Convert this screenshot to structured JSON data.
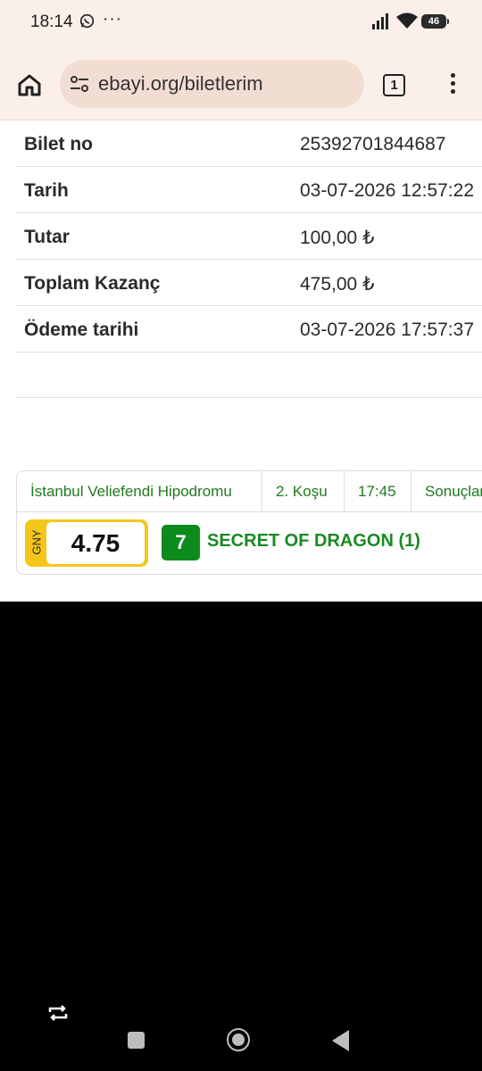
{
  "status": {
    "time": "18:14",
    "dots": "···",
    "battery": "46"
  },
  "browser": {
    "url": "ebayi.org/biletlerim",
    "tab_count": "1"
  },
  "ticket": {
    "rows": [
      {
        "label": "Bilet no",
        "value": "25392701844687"
      },
      {
        "label": "Tarih",
        "value": "03-07-2026 12:57:22"
      },
      {
        "label": "Tutar",
        "value": "100,00 ₺"
      },
      {
        "label": "Toplam Kazanç",
        "value": "475,00 ₺"
      },
      {
        "label": "Ödeme tarihi",
        "value": "03-07-2026 17:57:37"
      }
    ]
  },
  "race": {
    "track": "İstanbul Veliefendi Hipodromu",
    "race_no": "2. Koşu",
    "time": "17:45",
    "result": "Sonuçlandı",
    "odds_label": "GNY",
    "odds_value": "4.75",
    "horse_number": "7",
    "horse_name": "SECRET OF DRAGON (1)"
  },
  "icons": [
    "whatsapp-icon",
    "signal-icon",
    "wifi-icon",
    "home-icon",
    "site-settings-icon",
    "more-vert-icon",
    "rotate-icon"
  ]
}
